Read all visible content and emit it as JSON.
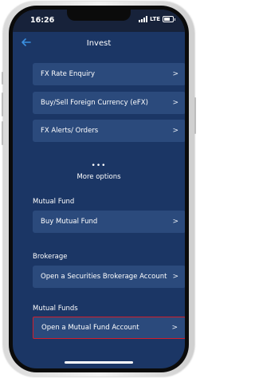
{
  "status": {
    "time": "16:26",
    "network": "LTE"
  },
  "header": {
    "title": "Invest"
  },
  "menu_items": [
    {
      "label": "FX Rate Enquiry"
    },
    {
      "label": "Buy/Sell Foreign Currency (eFX)"
    },
    {
      "label": "FX Alerts/ Orders"
    }
  ],
  "more": {
    "dots": "•••",
    "label": "More options"
  },
  "sections": {
    "mutual_fund": {
      "title": "Mutual Fund",
      "item": "Buy Mutual Fund"
    },
    "brokerage": {
      "title": "Brokerage",
      "item": "Open a Securities Brokerage Account"
    },
    "mutual_funds": {
      "title": "Mutual Funds",
      "item": "Open a Mutual Fund Account"
    }
  },
  "chevron": ">",
  "colors": {
    "background": "#1b3665",
    "card": "#2b4a7c",
    "highlight_border": "#d21e2a",
    "back_arrow": "#3b8fe0"
  }
}
